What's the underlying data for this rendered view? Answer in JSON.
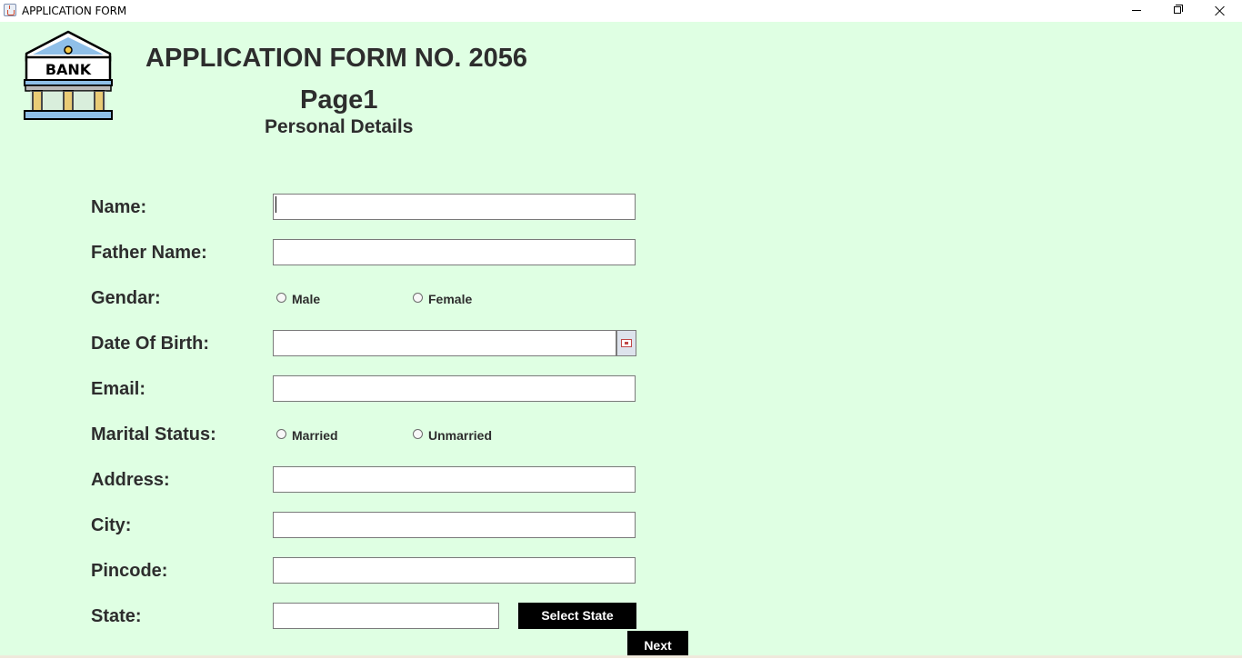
{
  "window": {
    "title": "APPLICATION FORM",
    "controls": [
      "minimize",
      "maximize",
      "close"
    ]
  },
  "logo": {
    "text": "BANK",
    "icon": "bank-building-icon"
  },
  "header": {
    "form_title": "APPLICATION FORM NO. 2056",
    "page": "Page1",
    "section": "Personal Details"
  },
  "fields": {
    "name": {
      "label": "Name:",
      "value": ""
    },
    "father_name": {
      "label": "Father Name:",
      "value": ""
    },
    "gender": {
      "label": "Gendar:",
      "options": [
        "Male",
        "Female"
      ],
      "selected": null
    },
    "dob": {
      "label": "Date Of Birth:",
      "value": "",
      "picker_icon": "calendar-icon"
    },
    "email": {
      "label": "Email:",
      "value": ""
    },
    "marital_status": {
      "label": "Marital Status:",
      "options": [
        "Married",
        "Unmarried"
      ],
      "selected": null
    },
    "address": {
      "label": "Address:",
      "value": ""
    },
    "city": {
      "label": "City:",
      "value": ""
    },
    "pincode": {
      "label": "Pincode:",
      "value": ""
    },
    "state": {
      "label": "State:",
      "value": ""
    }
  },
  "buttons": {
    "select_state": "Select State",
    "next": "Next"
  },
  "colors": {
    "background": "#dfffe3",
    "text": "#2d2d2d",
    "button_bg": "#000000",
    "button_text": "#ffffff"
  }
}
